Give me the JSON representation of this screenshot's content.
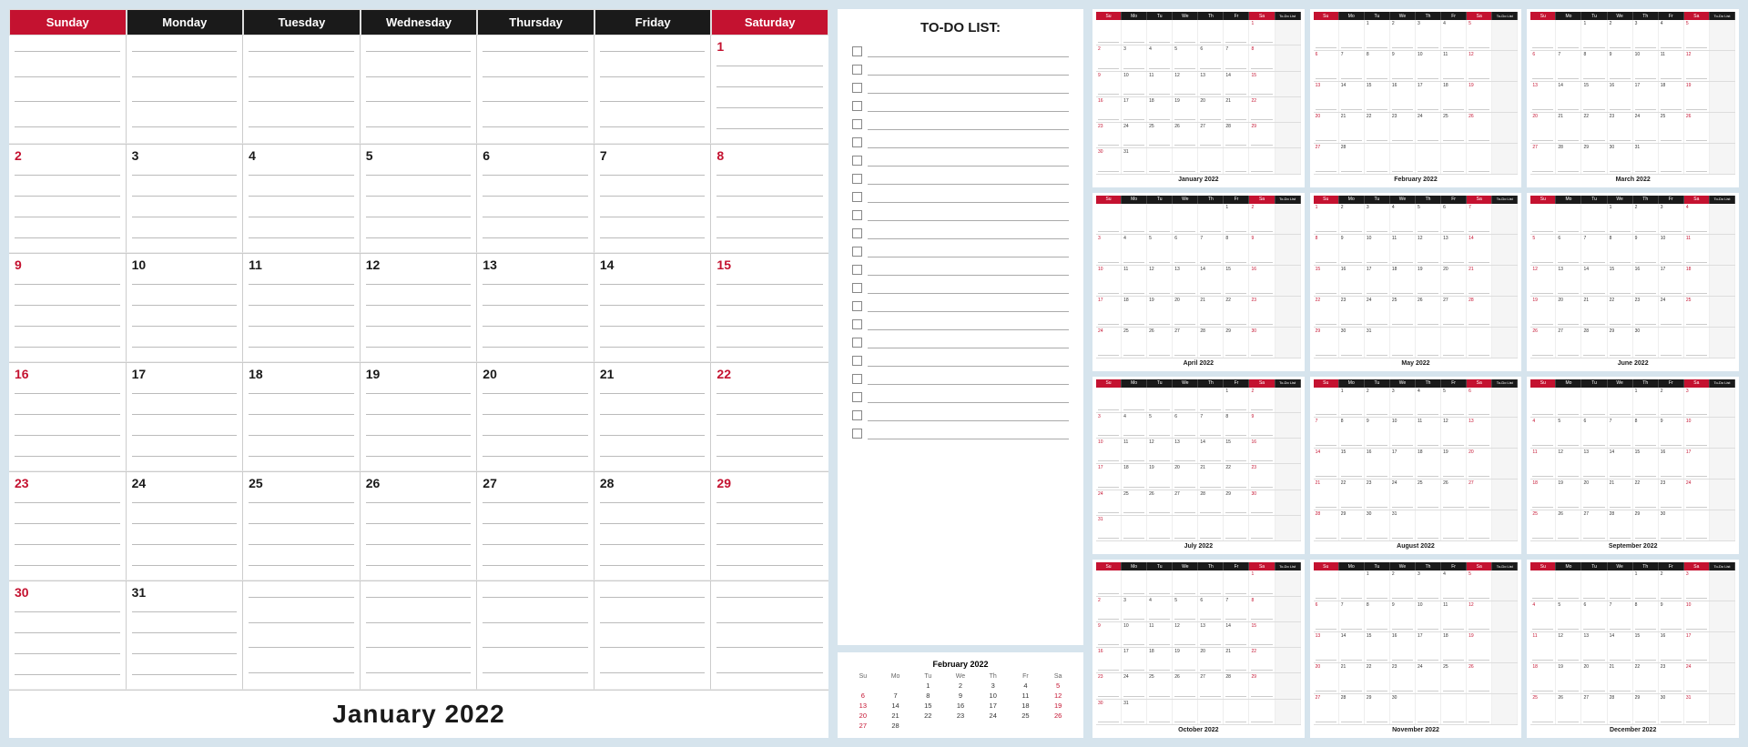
{
  "mainCalendar": {
    "title": "January 2022",
    "headers": [
      "Sunday",
      "Monday",
      "Tuesday",
      "Wednesday",
      "Thursday",
      "Friday",
      "Saturday"
    ],
    "weeks": [
      [
        {
          "num": "",
          "red": false
        },
        {
          "num": "",
          "red": false
        },
        {
          "num": "",
          "red": false
        },
        {
          "num": "",
          "red": false
        },
        {
          "num": "",
          "red": false
        },
        {
          "num": "",
          "red": false
        },
        {
          "num": "1",
          "red": true
        }
      ],
      [
        {
          "num": "2",
          "red": true
        },
        {
          "num": "3",
          "red": false
        },
        {
          "num": "4",
          "red": false
        },
        {
          "num": "5",
          "red": false
        },
        {
          "num": "6",
          "red": false
        },
        {
          "num": "7",
          "red": false
        },
        {
          "num": "8",
          "red": true
        }
      ],
      [
        {
          "num": "9",
          "red": true
        },
        {
          "num": "10",
          "red": false
        },
        {
          "num": "11",
          "red": false
        },
        {
          "num": "12",
          "red": false
        },
        {
          "num": "13",
          "red": false
        },
        {
          "num": "14",
          "red": false
        },
        {
          "num": "15",
          "red": true
        }
      ],
      [
        {
          "num": "16",
          "red": true
        },
        {
          "num": "17",
          "red": false
        },
        {
          "num": "18",
          "red": false
        },
        {
          "num": "19",
          "red": false
        },
        {
          "num": "20",
          "red": false
        },
        {
          "num": "21",
          "red": false
        },
        {
          "num": "22",
          "red": true
        }
      ],
      [
        {
          "num": "23",
          "red": true
        },
        {
          "num": "24",
          "red": false
        },
        {
          "num": "25",
          "red": false
        },
        {
          "num": "26",
          "red": false
        },
        {
          "num": "27",
          "red": false
        },
        {
          "num": "28",
          "red": false
        },
        {
          "num": "29",
          "red": true
        }
      ],
      [
        {
          "num": "30",
          "red": true
        },
        {
          "num": "31",
          "red": false
        },
        {
          "num": "",
          "red": false
        },
        {
          "num": "",
          "red": false
        },
        {
          "num": "",
          "red": false
        },
        {
          "num": "",
          "red": false
        },
        {
          "num": "",
          "red": false
        }
      ]
    ]
  },
  "todoList": {
    "title": "TO-DO LIST:",
    "items": 22
  },
  "miniCalendar": {
    "title": "February 2022",
    "headers": [
      "Su",
      "Mo",
      "Tu",
      "We",
      "Th",
      "Fr",
      "Sa"
    ],
    "weeks": [
      [
        "",
        "",
        "1",
        "2",
        "3",
        "4",
        "5"
      ],
      [
        "6",
        "7",
        "8",
        "9",
        "10",
        "11",
        "12"
      ],
      [
        "13",
        "14",
        "15",
        "16",
        "17",
        "18",
        "19"
      ],
      [
        "20",
        "21",
        "22",
        "23",
        "24",
        "25",
        "26"
      ],
      [
        "27",
        "28",
        "",
        "",
        "",
        "",
        ""
      ]
    ],
    "redDays": [
      "6",
      "13",
      "20",
      "27",
      "5",
      "12",
      "19",
      "26"
    ]
  },
  "yearGrid": {
    "months": [
      "January 2022",
      "February 2022",
      "March 2022",
      "April 2022",
      "May 2022",
      "June 2022",
      "July 2022",
      "August 2022",
      "September 2022",
      "October 2022",
      "November 2022",
      "December 2022"
    ]
  }
}
